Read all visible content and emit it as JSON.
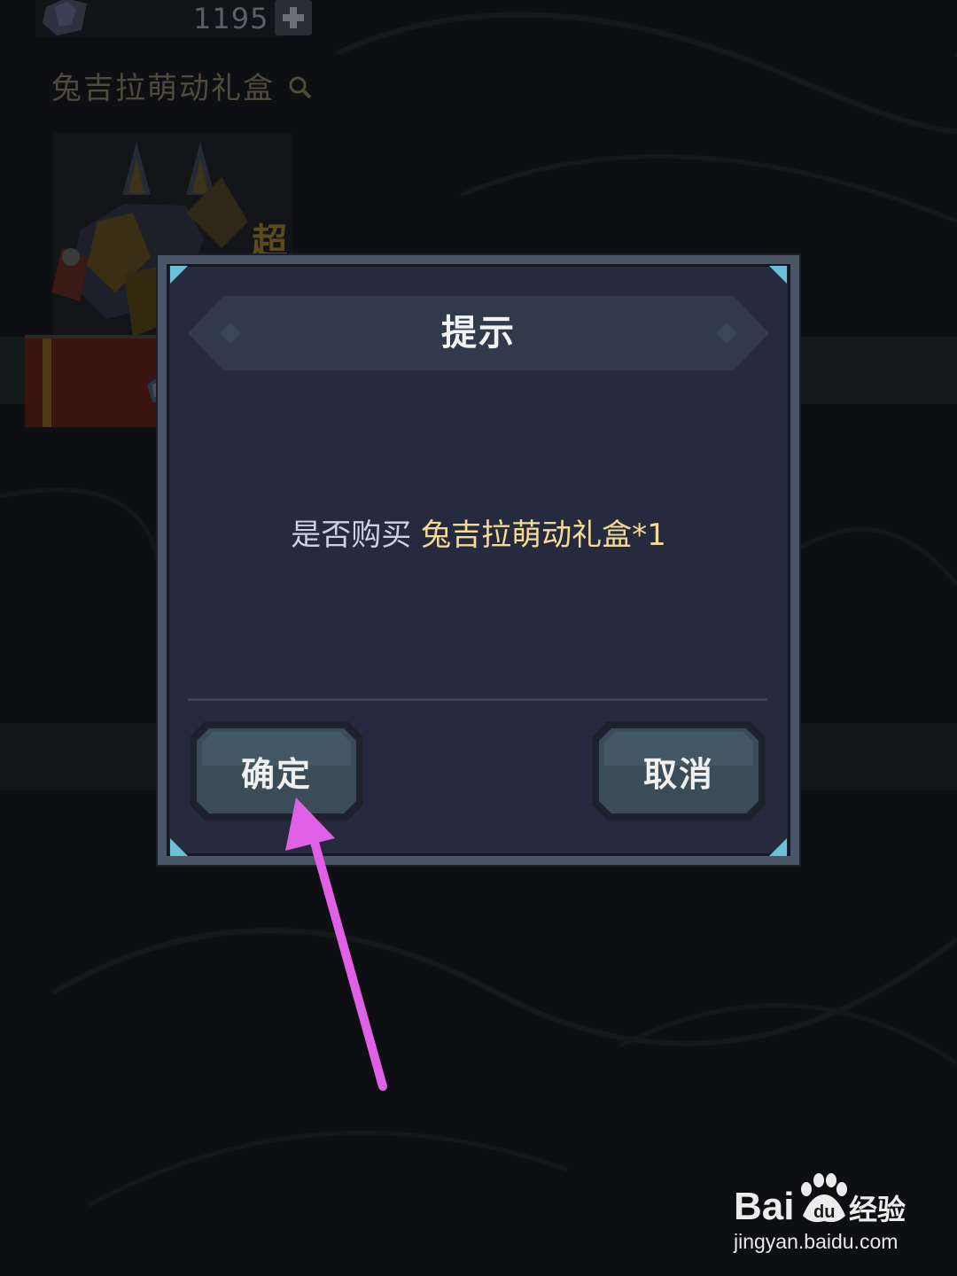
{
  "background": {
    "currency": {
      "value": "1195",
      "icon": "gem-icon",
      "add_icon": "plus-icon"
    },
    "item": {
      "title": "兔吉拉萌动礼盒",
      "search_icon": "search-icon",
      "tag": "超",
      "price_icon": "gem-icon"
    }
  },
  "dialog": {
    "title": "提示",
    "message_prefix": "是否购买 ",
    "message_item": "兔吉拉萌动礼盒*1",
    "confirm_label": "确定",
    "cancel_label": "取消"
  },
  "colors": {
    "dialog_bg": "#262a3e",
    "dialog_frame": "#4a5566",
    "highlight_text": "#f4db94",
    "message_text": "#c9d2e3",
    "button_fill": "#3a4c58",
    "arrow": "#e060e6"
  },
  "annotation": {
    "type": "arrow",
    "points_to": "confirm-button"
  },
  "watermark": {
    "brand": "Bai du 经验",
    "url": "jingyan.baidu.com"
  }
}
